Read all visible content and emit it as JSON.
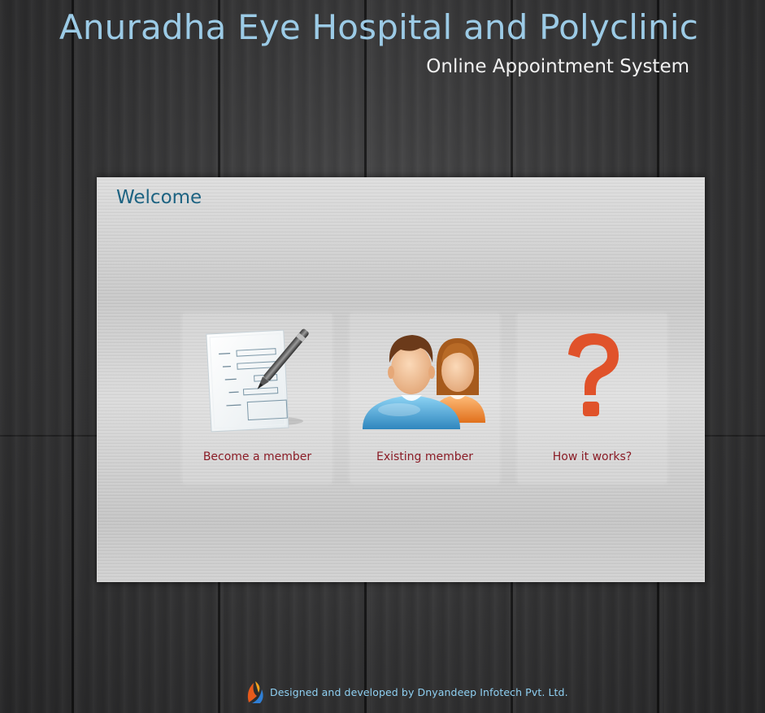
{
  "header": {
    "title": "Anuradha Eye Hospital and Polyclinic",
    "subtitle": "Online Appointment System"
  },
  "panel": {
    "title": "Welcome",
    "tiles": [
      {
        "label": "Become a member",
        "icon": "registration-form-icon"
      },
      {
        "label": "Existing member",
        "icon": "members-icon"
      },
      {
        "label": "How it works?",
        "icon": "question-mark-icon"
      }
    ]
  },
  "footer": {
    "credit": "Designed and developed by Dnyandeep Infotech Pvt. Ltd.",
    "logo_icon": "company-logo-icon"
  },
  "colors": {
    "title": "#9ccbe6",
    "panel_title": "#1d6382",
    "tile_label": "#8a1c26",
    "footer_text": "#8fd0f2",
    "question_mark": "#e0522a"
  }
}
